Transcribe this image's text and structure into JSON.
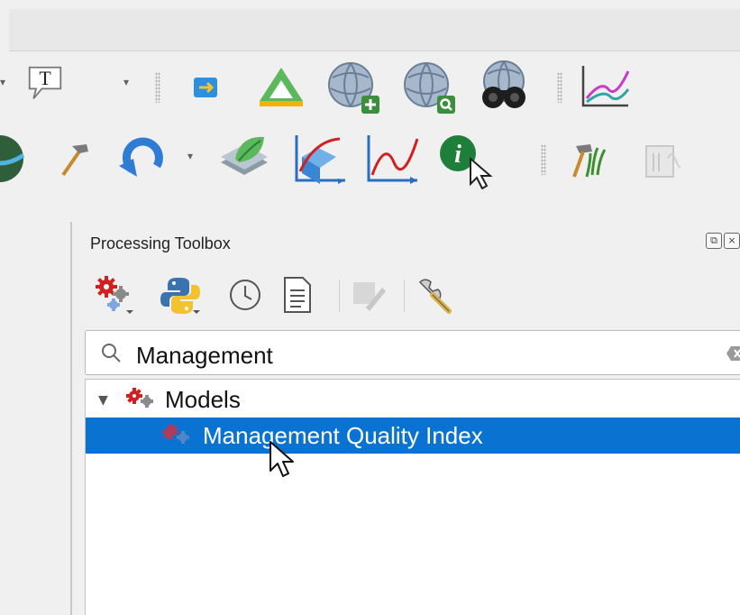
{
  "toolbar_top": {
    "icons": [
      "text-annotation-icon",
      "add-map-decoration-icon",
      "georeferencer-icon",
      "add-wms-layer-icon",
      "find-wms-layer-icon",
      "binoculars-search-icon",
      "profile-graph-icon"
    ]
  },
  "toolbar_bottom": {
    "icons": [
      "globe-icon",
      "hammer-build-icon",
      "refresh-arrow-icon",
      "plugin-layer-icon",
      "3d-graph-icon",
      "line-graph-icon",
      "identify-features-icon",
      "processing-tools-icon",
      "disabled-layout-icon"
    ]
  },
  "dock": {
    "title": "Processing Toolbox",
    "tools": [
      "models-icon",
      "python-icon",
      "history-icon",
      "results-viewer-icon",
      "edit-features-in-place-icon",
      "options-wrench-icon"
    ]
  },
  "search": {
    "value": "Management",
    "placeholder": ""
  },
  "tree": {
    "group_label": "Models",
    "items": [
      {
        "label": "Management Quality Index",
        "selected": true
      }
    ]
  },
  "colors": {
    "selection": "#0a73d1",
    "accent_red": "#d21f1f"
  }
}
